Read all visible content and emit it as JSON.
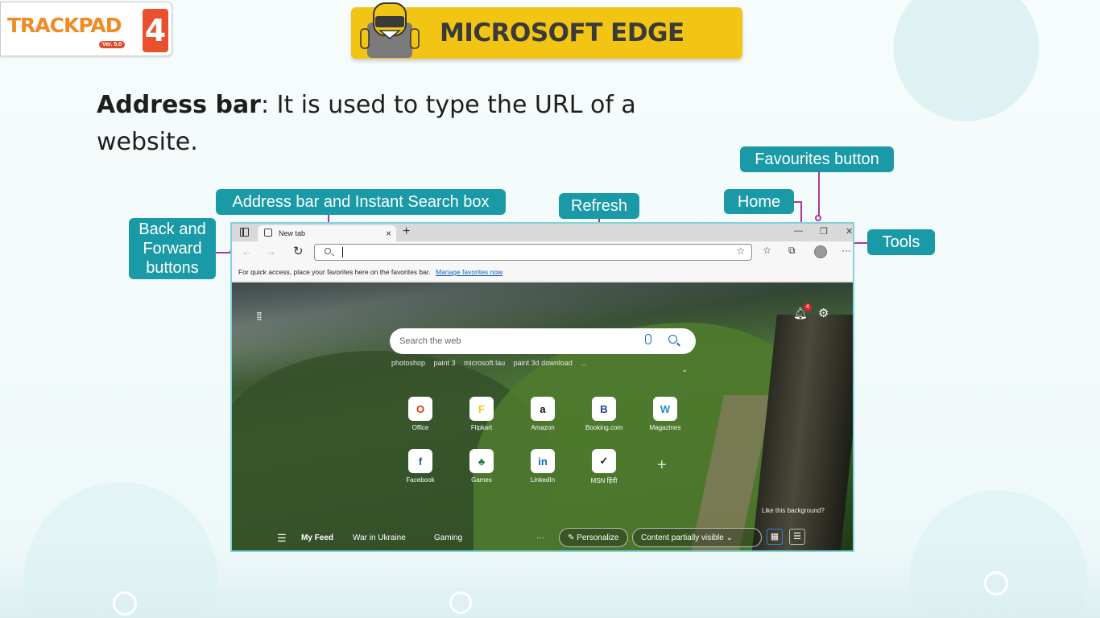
{
  "logo": {
    "text": "TRACKPAD",
    "version": "Ver. 5.0",
    "number": "4"
  },
  "banner": {
    "title": "MICROSOFT EDGE"
  },
  "intro": {
    "term": "Address bar",
    "definition": ": It is used to type the URL of a website."
  },
  "callouts": {
    "address_bar": "Address bar and Instant Search box",
    "refresh": "Refresh",
    "favourites": "Favourites button",
    "home": "Home",
    "tools": "Tools",
    "back_forward": "Back and Forward buttons"
  },
  "browser": {
    "tab_title": "New tab",
    "favbar_text": "For quick access, place your favorites here on the favorites bar.",
    "favbar_link": "Manage favorites now",
    "search_placeholder": "Search the web",
    "suggestions": [
      "photoshop",
      "paint 3",
      "microsoft lau",
      "paint 3d download",
      "..."
    ],
    "notification_count": "4",
    "sites_row1": [
      {
        "label": "Office",
        "glyph": "O",
        "color": "#d83b01"
      },
      {
        "label": "Flipkart",
        "glyph": "F",
        "color": "#f5c518"
      },
      {
        "label": "Amazon",
        "glyph": "a",
        "color": "#111111"
      },
      {
        "label": "Booking.com",
        "glyph": "B",
        "color": "#1d3f8f"
      },
      {
        "label": "Magazines",
        "glyph": "W",
        "color": "#2a8ac4"
      }
    ],
    "sites_row2": [
      {
        "label": "Facebook",
        "glyph": "f",
        "color": "#1b56a8"
      },
      {
        "label": "Games",
        "glyph": "♣",
        "color": "#1e7a3c"
      },
      {
        "label": "LinkedIn",
        "glyph": "in",
        "color": "#0a66c2"
      },
      {
        "label": "MSN हिंदी",
        "glyph": "✓",
        "color": "#222222"
      }
    ],
    "like_background": "Like this background?",
    "feed": {
      "my_feed": "My Feed",
      "war": "War in Ukraine",
      "gaming": "Gaming",
      "personalize": "Personalize",
      "content_visibility": "Content partially visible"
    }
  },
  "colors": {
    "callout": "#1a9aa6",
    "leader": "#b0359a",
    "banner": "#f2c514"
  }
}
